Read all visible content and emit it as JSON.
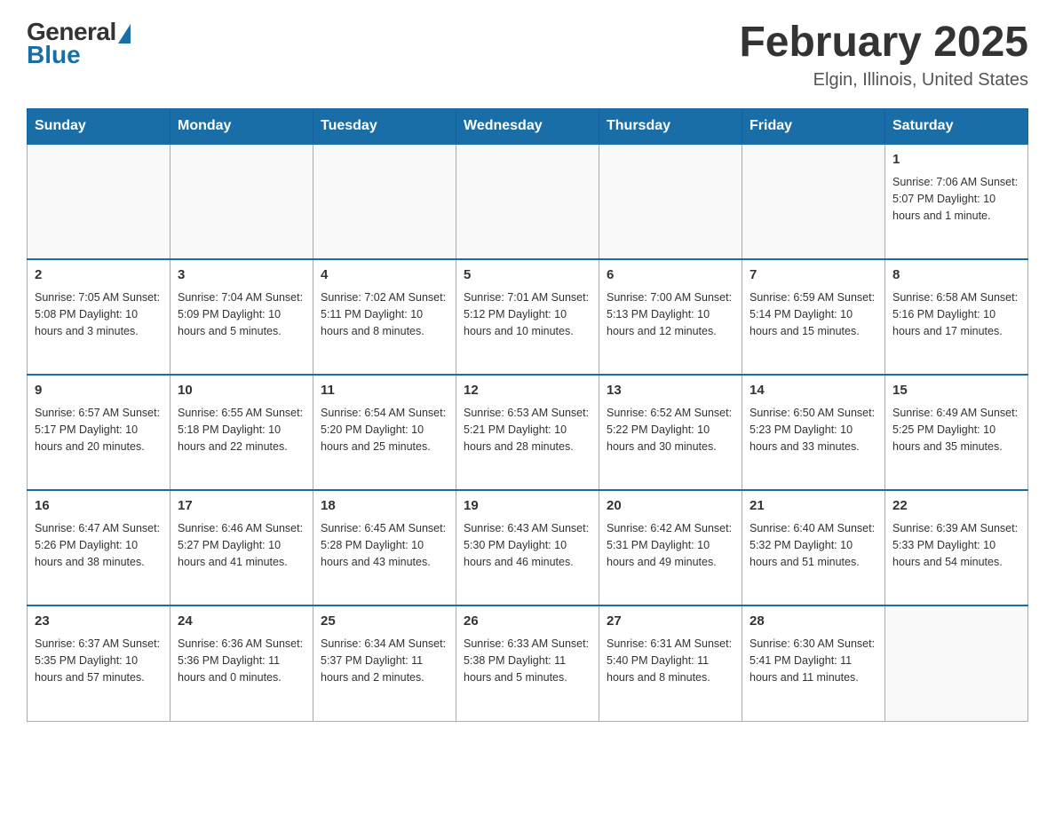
{
  "header": {
    "logo_general": "General",
    "logo_blue": "Blue",
    "month_title": "February 2025",
    "location": "Elgin, Illinois, United States"
  },
  "days_of_week": [
    "Sunday",
    "Monday",
    "Tuesday",
    "Wednesday",
    "Thursday",
    "Friday",
    "Saturday"
  ],
  "weeks": [
    {
      "days": [
        {
          "date": "",
          "info": ""
        },
        {
          "date": "",
          "info": ""
        },
        {
          "date": "",
          "info": ""
        },
        {
          "date": "",
          "info": ""
        },
        {
          "date": "",
          "info": ""
        },
        {
          "date": "",
          "info": ""
        },
        {
          "date": "1",
          "info": "Sunrise: 7:06 AM\nSunset: 5:07 PM\nDaylight: 10 hours and 1 minute."
        }
      ]
    },
    {
      "days": [
        {
          "date": "2",
          "info": "Sunrise: 7:05 AM\nSunset: 5:08 PM\nDaylight: 10 hours and 3 minutes."
        },
        {
          "date": "3",
          "info": "Sunrise: 7:04 AM\nSunset: 5:09 PM\nDaylight: 10 hours and 5 minutes."
        },
        {
          "date": "4",
          "info": "Sunrise: 7:02 AM\nSunset: 5:11 PM\nDaylight: 10 hours and 8 minutes."
        },
        {
          "date": "5",
          "info": "Sunrise: 7:01 AM\nSunset: 5:12 PM\nDaylight: 10 hours and 10 minutes."
        },
        {
          "date": "6",
          "info": "Sunrise: 7:00 AM\nSunset: 5:13 PM\nDaylight: 10 hours and 12 minutes."
        },
        {
          "date": "7",
          "info": "Sunrise: 6:59 AM\nSunset: 5:14 PM\nDaylight: 10 hours and 15 minutes."
        },
        {
          "date": "8",
          "info": "Sunrise: 6:58 AM\nSunset: 5:16 PM\nDaylight: 10 hours and 17 minutes."
        }
      ]
    },
    {
      "days": [
        {
          "date": "9",
          "info": "Sunrise: 6:57 AM\nSunset: 5:17 PM\nDaylight: 10 hours and 20 minutes."
        },
        {
          "date": "10",
          "info": "Sunrise: 6:55 AM\nSunset: 5:18 PM\nDaylight: 10 hours and 22 minutes."
        },
        {
          "date": "11",
          "info": "Sunrise: 6:54 AM\nSunset: 5:20 PM\nDaylight: 10 hours and 25 minutes."
        },
        {
          "date": "12",
          "info": "Sunrise: 6:53 AM\nSunset: 5:21 PM\nDaylight: 10 hours and 28 minutes."
        },
        {
          "date": "13",
          "info": "Sunrise: 6:52 AM\nSunset: 5:22 PM\nDaylight: 10 hours and 30 minutes."
        },
        {
          "date": "14",
          "info": "Sunrise: 6:50 AM\nSunset: 5:23 PM\nDaylight: 10 hours and 33 minutes."
        },
        {
          "date": "15",
          "info": "Sunrise: 6:49 AM\nSunset: 5:25 PM\nDaylight: 10 hours and 35 minutes."
        }
      ]
    },
    {
      "days": [
        {
          "date": "16",
          "info": "Sunrise: 6:47 AM\nSunset: 5:26 PM\nDaylight: 10 hours and 38 minutes."
        },
        {
          "date": "17",
          "info": "Sunrise: 6:46 AM\nSunset: 5:27 PM\nDaylight: 10 hours and 41 minutes."
        },
        {
          "date": "18",
          "info": "Sunrise: 6:45 AM\nSunset: 5:28 PM\nDaylight: 10 hours and 43 minutes."
        },
        {
          "date": "19",
          "info": "Sunrise: 6:43 AM\nSunset: 5:30 PM\nDaylight: 10 hours and 46 minutes."
        },
        {
          "date": "20",
          "info": "Sunrise: 6:42 AM\nSunset: 5:31 PM\nDaylight: 10 hours and 49 minutes."
        },
        {
          "date": "21",
          "info": "Sunrise: 6:40 AM\nSunset: 5:32 PM\nDaylight: 10 hours and 51 minutes."
        },
        {
          "date": "22",
          "info": "Sunrise: 6:39 AM\nSunset: 5:33 PM\nDaylight: 10 hours and 54 minutes."
        }
      ]
    },
    {
      "days": [
        {
          "date": "23",
          "info": "Sunrise: 6:37 AM\nSunset: 5:35 PM\nDaylight: 10 hours and 57 minutes."
        },
        {
          "date": "24",
          "info": "Sunrise: 6:36 AM\nSunset: 5:36 PM\nDaylight: 11 hours and 0 minutes."
        },
        {
          "date": "25",
          "info": "Sunrise: 6:34 AM\nSunset: 5:37 PM\nDaylight: 11 hours and 2 minutes."
        },
        {
          "date": "26",
          "info": "Sunrise: 6:33 AM\nSunset: 5:38 PM\nDaylight: 11 hours and 5 minutes."
        },
        {
          "date": "27",
          "info": "Sunrise: 6:31 AM\nSunset: 5:40 PM\nDaylight: 11 hours and 8 minutes."
        },
        {
          "date": "28",
          "info": "Sunrise: 6:30 AM\nSunset: 5:41 PM\nDaylight: 11 hours and 11 minutes."
        },
        {
          "date": "",
          "info": ""
        }
      ]
    }
  ]
}
